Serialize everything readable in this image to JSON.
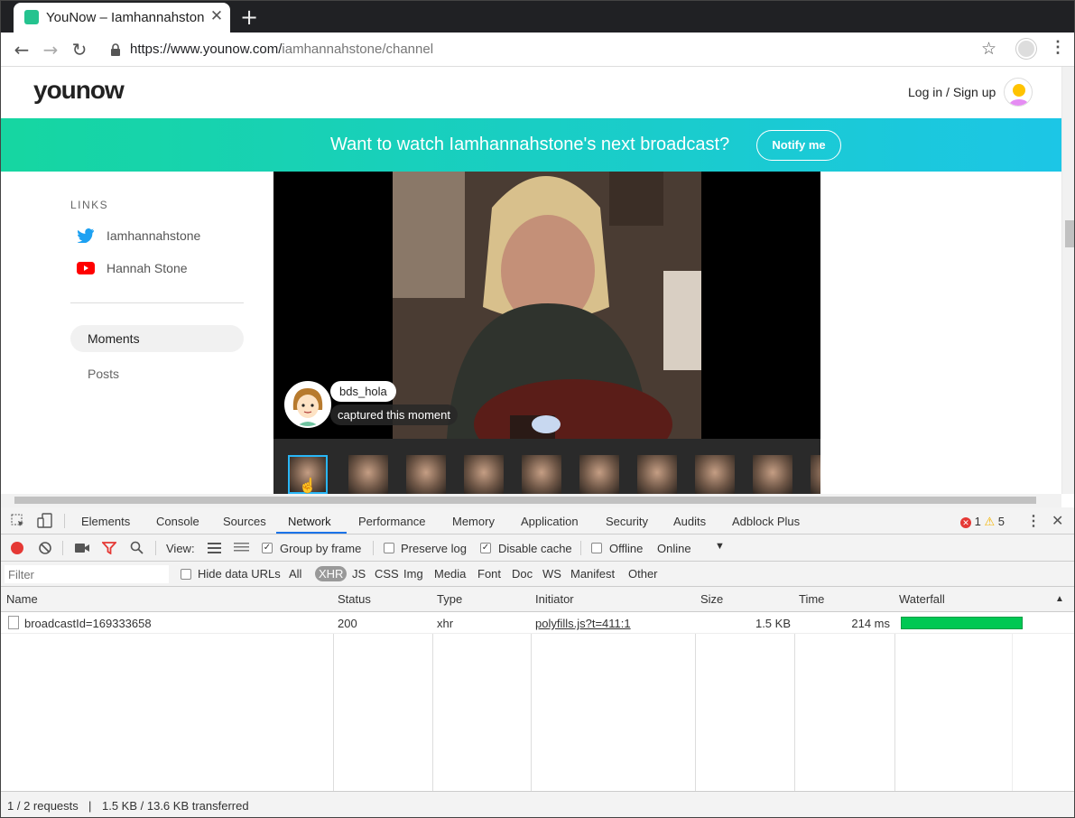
{
  "browser": {
    "tab_title": "YouNow – Iamhannahstone",
    "url_host": "https://www.younow.com/",
    "url_path": "iamhannahstone/channel",
    "new_tab_symbol": "+",
    "close_symbol": "✕"
  },
  "site": {
    "logo": "younow",
    "login_label": "Log in / Sign up",
    "banner_text": "Want to watch Iamhannahstone's next broadcast?",
    "notify_label": "Notify me"
  },
  "sidebar": {
    "links_title": "LINKS",
    "links": [
      {
        "label": "Iamhannahstone",
        "icon": "twitter-icon"
      },
      {
        "label": "Hannah Stone",
        "icon": "youtube-icon"
      }
    ],
    "nav": [
      {
        "label": "Moments",
        "active": true
      },
      {
        "label": "Posts",
        "active": false
      }
    ]
  },
  "moment": {
    "user": "bds_hola",
    "caption": "captured this moment",
    "thumb_count": 10
  },
  "devtools": {
    "tabs": [
      "Elements",
      "Console",
      "Sources",
      "Network",
      "Performance",
      "Memory",
      "Application",
      "Security",
      "Audits",
      "Adblock Plus"
    ],
    "active_tab": "Network",
    "errors": "1",
    "warnings": "5",
    "toolbar": {
      "view_label": "View:",
      "group_by_frame": "Group by frame",
      "preserve_log": "Preserve log",
      "disable_cache": "Disable cache",
      "offline": "Offline",
      "throttle": "Online"
    },
    "filter": {
      "placeholder": "Filter",
      "hide_data_urls": "Hide data URLs",
      "types": [
        "All",
        "XHR",
        "JS",
        "CSS",
        "Img",
        "Media",
        "Font",
        "Doc",
        "WS",
        "Manifest",
        "Other"
      ],
      "active_type": "XHR"
    },
    "columns": [
      "Name",
      "Status",
      "Type",
      "Initiator",
      "Size",
      "Time",
      "Waterfall"
    ],
    "rows": [
      {
        "name": "broadcastId=169333658",
        "status": "200",
        "type": "xhr",
        "initiator": "polyfills.js?t=411:1",
        "size": "1.5 KB",
        "time": "214 ms"
      }
    ],
    "status": {
      "requests": "1 / 2 requests",
      "separator": "|",
      "transferred": "1.5 KB / 13.6 KB transferred"
    }
  },
  "colors": {
    "brand_green": "#16d6a1",
    "brand_cyan": "#1cc6e6",
    "devtools_active": "#1a73e8",
    "waterfall": "#00c853"
  }
}
